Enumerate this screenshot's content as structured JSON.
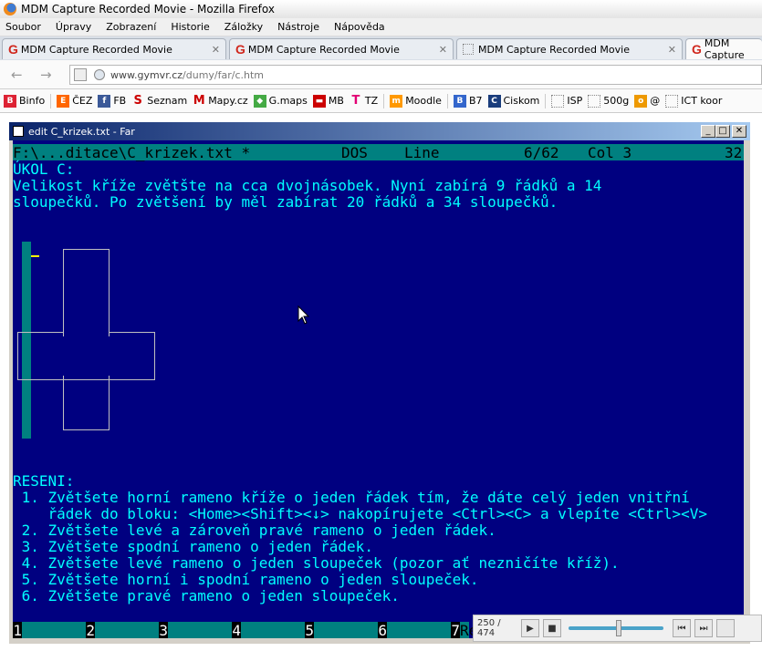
{
  "firefox": {
    "window_title": "MDM Capture Recorded Movie - Mozilla Firefox",
    "menu": [
      "Soubor",
      "Úpravy",
      "Zobrazení",
      "Historie",
      "Záložky",
      "Nástroje",
      "Nápověda"
    ],
    "tabs": [
      {
        "label": "MDM Capture Recorded Movie",
        "icon": "google-g-icon"
      },
      {
        "label": "MDM Capture Recorded Movie",
        "icon": "google-g-icon"
      },
      {
        "label": "MDM Capture Recorded Movie",
        "icon": "blank-page-icon"
      },
      {
        "label": "MDM Capture",
        "icon": "google-g-icon"
      }
    ],
    "url": {
      "host": "www.gymvr.cz",
      "path": "/dumy/far/c.htm"
    },
    "bookmarks": [
      "Binfo",
      "ČEZ",
      "FB",
      "Seznam",
      "Mapy.cz",
      "G.maps",
      "MB",
      "TZ",
      "Moodle",
      "B7",
      "Ciskom",
      "ISP",
      "500g",
      "@",
      "ICT koor"
    ]
  },
  "far": {
    "window_title": "edit C_krizek.txt - Far",
    "status": {
      "file": "F:\\...ditace\\C_krizek.txt *",
      "encoding": "DOS",
      "mode": "Line",
      "position": "6/62",
      "column": "Col 3",
      "code": "32"
    },
    "task_lines": [
      "ÚKOL C:",
      "Velikost kříže zvětšte na cca dvojnásobek. Nyní zabírá 9 řádků a 14",
      "sloupečků. Po zvětšení by měl zabírat 20 řádků a 34 sloupečků."
    ],
    "solution_lines": [
      "RESENI:",
      " 1. Zvětšete horní rameno kříže o jeden řádek tím, že dáte celý jeden vnitřní",
      "    řádek do bloku: <Home><Shift><↓> nakopírujete <Ctrl><C> a vlepíte <Ctrl><V>",
      " 2. Zvětšete levé a zároveň pravé rameno o jeden řádek.",
      " 3. Zvětšete spodní rameno o jeden řádek.",
      " 4. Zvětšete levé rameno o jeden sloupeček (pozor ať nezničíte kříž).",
      " 5. Zvětšete horní i spodní rameno o jeden sloupeček.",
      " 6. Zvětšete pravé rameno o jeden sloupeček."
    ],
    "keybar": [
      "1",
      "2",
      "3",
      "4",
      "5",
      "6",
      "7"
    ],
    "keybar_tail": "Re"
  },
  "media": {
    "time": "250 / 474",
    "progress": 0.53
  }
}
